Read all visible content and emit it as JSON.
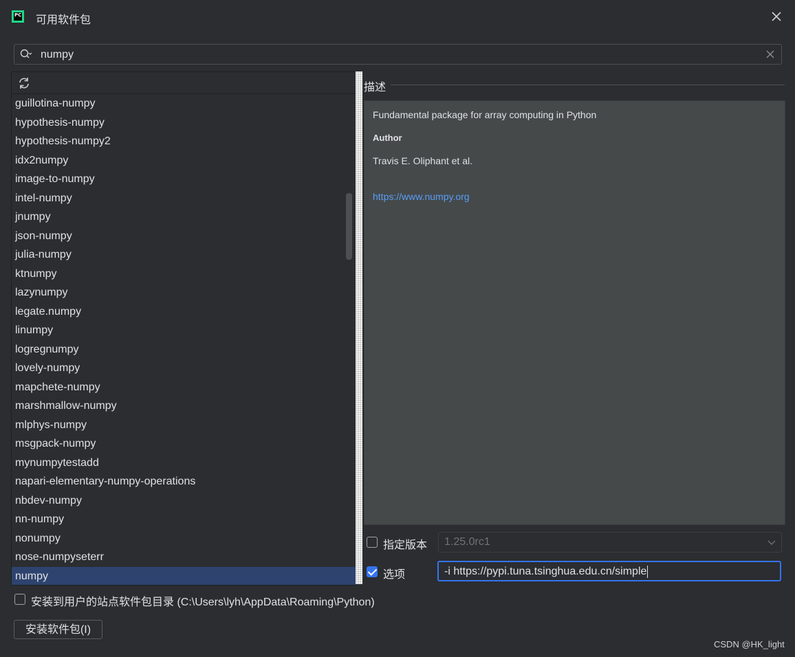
{
  "window": {
    "title": "可用软件包",
    "app_icon_text": "PC"
  },
  "search": {
    "value": "numpy"
  },
  "packages": [
    "guillotina-numpy",
    "hypothesis-numpy",
    "hypothesis-numpy2",
    "idx2numpy",
    "image-to-numpy",
    "intel-numpy",
    "jnumpy",
    "json-numpy",
    "julia-numpy",
    "ktnumpy",
    "lazynumpy",
    "legate.numpy",
    "linumpy",
    "logregnumpy",
    "lovely-numpy",
    "mapchete-numpy",
    "marshmallow-numpy",
    "mlphys-numpy",
    "msgpack-numpy",
    "mynumpytestadd",
    "napari-elementary-numpy-operations",
    "nbdev-numpy",
    "nn-numpy",
    "nonumpy",
    "nose-numpyseterr",
    "numpy"
  ],
  "selected_package": "numpy",
  "description": {
    "section_title": "描述",
    "summary": "Fundamental package for array computing in Python",
    "author_label": "Author",
    "author": "Travis E. Oliphant et al.",
    "link": "https://www.numpy.org"
  },
  "version": {
    "label": "指定版本",
    "checked": false,
    "value": "1.25.0rc1"
  },
  "options": {
    "label": "选项",
    "checked": true,
    "value": "-i https://pypi.tuna.tsinghua.edu.cn/simple"
  },
  "install_user": {
    "label": "安装到用户的站点软件包目录 (C:\\Users\\lyh\\AppData\\Roaming\\Python)",
    "checked": false
  },
  "install_button": {
    "label": "安装软件包(I)"
  },
  "watermark": "CSDN @HK_light",
  "colors": {
    "background": "#2b2d30",
    "accent": "#3574f0",
    "selection": "#2e436e",
    "link": "#589df6",
    "description_bg": "#45494a"
  }
}
